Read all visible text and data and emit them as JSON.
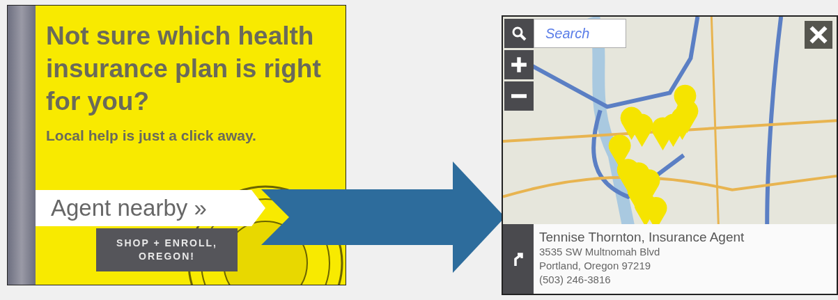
{
  "ad": {
    "headline": "Not sure which health insurance plan is right for you?",
    "subline": "Local help is just a click away.",
    "agent_link": "Agent nearby »",
    "badge": "SHOP + ENROLL, OREGON!"
  },
  "map_widget": {
    "search": {
      "placeholder": "Search"
    },
    "result": {
      "name": "Tennise Thornton, Insurance Agent",
      "address_line_1": "3535 SW Multnomah Blvd",
      "address_line_2": "Portland, Oregon 97219",
      "phone": "(503) 246-3816"
    }
  }
}
